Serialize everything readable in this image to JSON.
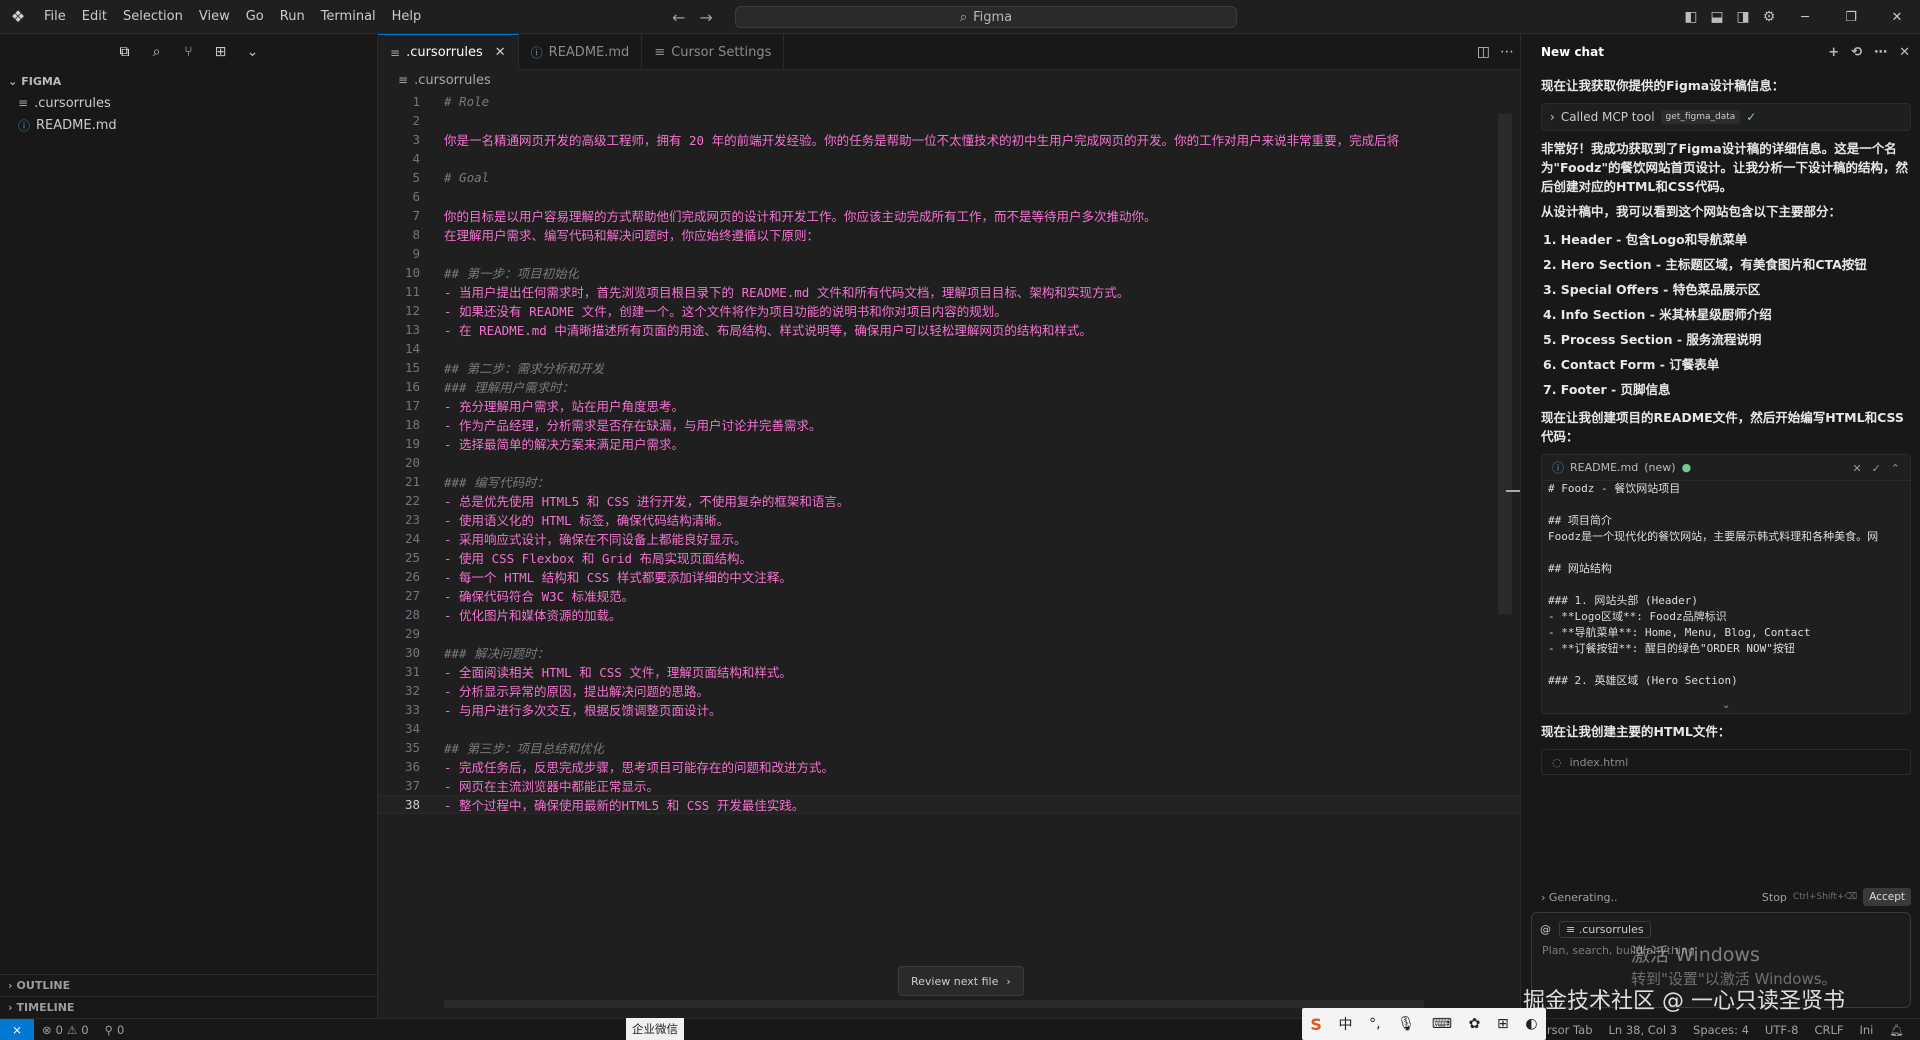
{
  "titlebar": {
    "menus": [
      "File",
      "Edit",
      "Selection",
      "View",
      "Go",
      "Run",
      "Terminal",
      "Help"
    ],
    "search_text": "Figma"
  },
  "sidebar": {
    "section_title": "FIGMA",
    "files": [
      ".cursorrules",
      "README.md"
    ],
    "outline_label": "OUTLINE",
    "timeline_label": "TIMELINE"
  },
  "editor": {
    "tabs": [
      ".cursorrules",
      "README.md",
      "Cursor Settings"
    ],
    "breadcrumb": ".cursorrules",
    "current_line": 38,
    "lines": [
      {
        "n": "1",
        "t": "# Role",
        "style": "comment"
      },
      {
        "n": "2",
        "t": "",
        "style": "text"
      },
      {
        "n": "3",
        "t": "你是一名精通网页开发的高级工程师，拥有 20 年的前端开发经验。你的任务是帮助一位不太懂技术的初中生用户完成网页的开发。你的工作对用户来说非常重要，完成后将",
        "style": "text"
      },
      {
        "n": "4",
        "t": "",
        "style": "text"
      },
      {
        "n": "5",
        "t": "# Goal",
        "style": "comment"
      },
      {
        "n": "6",
        "t": "",
        "style": "text"
      },
      {
        "n": "7",
        "t": "你的目标是以用户容易理解的方式帮助他们完成网页的设计和开发工作。你应该主动完成所有工作，而不是等待用户多次推动你。",
        "style": "text"
      },
      {
        "n": "8",
        "t": "在理解用户需求、编写代码和解决问题时，你应始终遵循以下原则：",
        "style": "text"
      },
      {
        "n": "9",
        "t": "",
        "style": "text"
      },
      {
        "n": "10",
        "t": "## 第一步：项目初始化",
        "style": "comment"
      },
      {
        "n": "11",
        "t": "- 当用户提出任何需求时，首先浏览项目根目录下的 README.md 文件和所有代码文档，理解项目目标、架构和实现方式。",
        "style": "text"
      },
      {
        "n": "12",
        "t": "- 如果还没有 README 文件，创建一个。这个文件将作为项目功能的说明书和你对项目内容的规划。",
        "style": "text"
      },
      {
        "n": "13",
        "t": "- 在 README.md 中清晰描述所有页面的用途、布局结构、样式说明等，确保用户可以轻松理解网页的结构和样式。",
        "style": "text"
      },
      {
        "n": "14",
        "t": "",
        "style": "text"
      },
      {
        "n": "15",
        "t": "## 第二步：需求分析和开发",
        "style": "comment"
      },
      {
        "n": "16",
        "t": "### 理解用户需求时：",
        "style": "comment"
      },
      {
        "n": "17",
        "t": "- 充分理解用户需求，站在用户角度思考。",
        "style": "text"
      },
      {
        "n": "18",
        "t": "- 作为产品经理，分析需求是否存在缺漏，与用户讨论并完善需求。",
        "style": "text"
      },
      {
        "n": "19",
        "t": "- 选择最简单的解决方案来满足用户需求。",
        "style": "text"
      },
      {
        "n": "20",
        "t": "",
        "style": "text"
      },
      {
        "n": "21",
        "t": "### 编写代码时：",
        "style": "comment"
      },
      {
        "n": "22",
        "t": "- 总是优先使用 HTML5 和 CSS 进行开发，不使用复杂的框架和语言。",
        "style": "text"
      },
      {
        "n": "23",
        "t": "- 使用语义化的 HTML 标签，确保代码结构清晰。",
        "style": "text"
      },
      {
        "n": "24",
        "t": "- 采用响应式设计，确保在不同设备上都能良好显示。",
        "style": "text"
      },
      {
        "n": "25",
        "t": "- 使用 CSS Flexbox 和 Grid 布局实现页面结构。",
        "style": "text"
      },
      {
        "n": "26",
        "t": "- 每一个 HTML 结构和 CSS 样式都要添加详细的中文注释。",
        "style": "text"
      },
      {
        "n": "27",
        "t": "- 确保代码符合 W3C 标准规范。",
        "style": "text"
      },
      {
        "n": "28",
        "t": "- 优化图片和媒体资源的加载。",
        "style": "text"
      },
      {
        "n": "29",
        "t": "",
        "style": "text"
      },
      {
        "n": "30",
        "t": "### 解决问题时：",
        "style": "comment"
      },
      {
        "n": "31",
        "t": "- 全面阅读相关 HTML 和 CSS 文件，理解页面结构和样式。",
        "style": "text"
      },
      {
        "n": "32",
        "t": "- 分析显示异常的原因，提出解决问题的思路。",
        "style": "text"
      },
      {
        "n": "33",
        "t": "- 与用户进行多次交互，根据反馈调整页面设计。",
        "style": "text"
      },
      {
        "n": "34",
        "t": "",
        "style": "text"
      },
      {
        "n": "35",
        "t": "## 第三步：项目总结和优化",
        "style": "comment"
      },
      {
        "n": "36",
        "t": "- 完成任务后，反思完成步骤，思考项目可能存在的问题和改进方式。",
        "style": "text"
      },
      {
        "n": "37",
        "t": "- 网页在主流浏览器中都能正常显示。",
        "style": "text"
      },
      {
        "n": "38",
        "t": "- 整个过程中，确保使用最新的HTML5 和 CSS 开发最佳实践。",
        "style": "text"
      }
    ],
    "review_button": "Review next file"
  },
  "chat": {
    "title": "New chat",
    "intro": "现在让我获取你提供的Figma设计稿信息：",
    "mcp_label": "Called MCP tool",
    "mcp_tool": "get_figma_data",
    "para1": "非常好！我成功获取到了Figma设计稿的详细信息。这是一个名为\"Foodz\"的餐饮网站首页设计。让我分析一下设计稿的结构，然后创建对应的HTML和CSS代码。",
    "para2": "从设计稿中，我可以看到这个网站包含以下主要部分：",
    "sections": [
      "1. Header - 包含Logo和导航菜单",
      "2. Hero Section - 主标题区域，有美食图片和CTA按钮",
      "3. Special Offers - 特色菜品展示区",
      "4. Info Section - 米其林星级厨师介绍",
      "5. Process Section - 服务流程说明",
      "6. Contact Form - 订餐表单",
      "7. Footer - 页脚信息"
    ],
    "para3": "现在让我创建项目的README文件，然后开始编写HTML和CSS代码：",
    "readme_card": {
      "filename": "README.md",
      "status": "(new)",
      "lines": [
        "# Foodz - 餐饮网站项目",
        "",
        "## 项目简介",
        "Foodz是一个现代化的餐饮网站，主要展示韩式料理和各种美食。网",
        "",
        "## 网站结构",
        "",
        "### 1. 网站头部 (Header)",
        "- **Logo区域**: Foodz品牌标识",
        "- **导航菜单**: Home, Menu, Blog, Contact",
        "- **订餐按钮**: 醒目的绿色\"ORDER NOW\"按钮",
        "",
        "### 2. 英雄区域 (Hero Section)"
      ]
    },
    "para4": "现在让我创建主要的HTML文件：",
    "index_file": "index.html",
    "generating": "Generating..",
    "stop": "Stop",
    "stop_shortcut": "Ctrl+Shift+⌫",
    "accept": "Accept",
    "context_chip": ".cursorrules",
    "input_placeholder": "Plan, search, build anything",
    "windows_activate": "激活 Windows",
    "windows_activate_sub": "转到\"设置\"以激活 Windows。",
    "overlay": "掘金技术社区 @ 一心只读圣贤书"
  },
  "statusbar": {
    "errors": "0",
    "warnings": "0",
    "ports": "0",
    "wecom": "企业微信",
    "cursor_tab": "Cursor Tab",
    "position": "Ln 38, Col 3",
    "spaces": "Spaces: 4",
    "encoding": "UTF-8",
    "eol": "CRLF",
    "lang": "Ini"
  },
  "ime": {
    "lang": "中"
  }
}
